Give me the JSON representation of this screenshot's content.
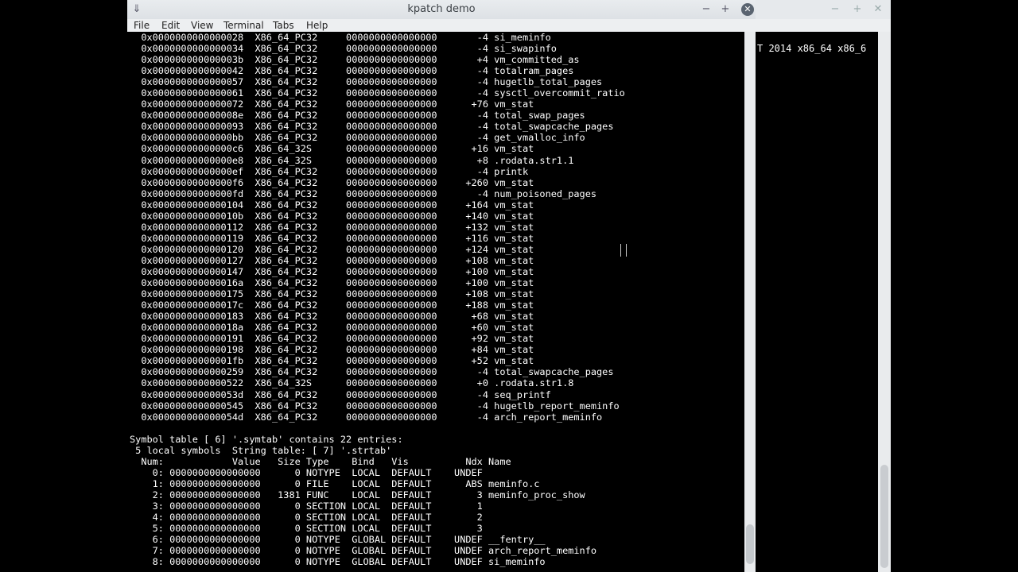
{
  "background_window": {
    "terminal_fragment": "T 2014 x86_64 x86_6",
    "controls": [
      "−",
      "+",
      "✕"
    ]
  },
  "window": {
    "title": "kpatch demo",
    "controls": [
      "−",
      "+",
      "✕"
    ]
  },
  "menu": {
    "file": "File",
    "edit": "Edit",
    "view": "View",
    "terminal": "Terminal",
    "tabs": "Tabs",
    "help": "Help"
  },
  "terminal_lines": [
    "  0x0000000000000028  X86_64_PC32     0000000000000000       -4 si_meminfo",
    "  0x0000000000000034  X86_64_PC32     0000000000000000       -4 si_swapinfo",
    "  0x000000000000003b  X86_64_PC32     0000000000000000       +4 vm_committed_as",
    "  0x0000000000000042  X86_64_PC32     0000000000000000       -4 totalram_pages",
    "  0x0000000000000057  X86_64_PC32     0000000000000000       -4 hugetlb_total_pages",
    "  0x0000000000000061  X86_64_PC32     0000000000000000       -4 sysctl_overcommit_ratio",
    "  0x0000000000000072  X86_64_PC32     0000000000000000      +76 vm_stat",
    "  0x000000000000008e  X86_64_PC32     0000000000000000       -4 total_swap_pages",
    "  0x0000000000000093  X86_64_PC32     0000000000000000       -4 total_swapcache_pages",
    "  0x00000000000000bb  X86_64_PC32     0000000000000000       -4 get_vmalloc_info",
    "  0x00000000000000c6  X86_64_32S      0000000000000000      +16 vm_stat",
    "  0x00000000000000e8  X86_64_32S      0000000000000000       +8 .rodata.str1.1",
    "  0x00000000000000ef  X86_64_PC32     0000000000000000       -4 printk",
    "  0x00000000000000f6  X86_64_PC32     0000000000000000     +260 vm_stat",
    "  0x00000000000000fd  X86_64_PC32     0000000000000000       -4 num_poisoned_pages",
    "  0x0000000000000104  X86_64_PC32     0000000000000000     +164 vm_stat",
    "  0x000000000000010b  X86_64_PC32     0000000000000000     +140 vm_stat",
    "  0x0000000000000112  X86_64_PC32     0000000000000000     +132 vm_stat",
    "  0x0000000000000119  X86_64_PC32     0000000000000000     +116 vm_stat",
    "  0x0000000000000120  X86_64_PC32     0000000000000000     +124 vm_stat",
    "  0x0000000000000127  X86_64_PC32     0000000000000000     +108 vm_stat",
    "  0x0000000000000147  X86_64_PC32     0000000000000000     +100 vm_stat",
    "  0x000000000000016a  X86_64_PC32     0000000000000000     +100 vm_stat",
    "  0x0000000000000175  X86_64_PC32     0000000000000000     +108 vm_stat",
    "  0x000000000000017c  X86_64_PC32     0000000000000000     +188 vm_stat",
    "  0x0000000000000183  X86_64_PC32     0000000000000000      +68 vm_stat",
    "  0x000000000000018a  X86_64_PC32     0000000000000000      +60 vm_stat",
    "  0x0000000000000191  X86_64_PC32     0000000000000000      +92 vm_stat",
    "  0x0000000000000198  X86_64_PC32     0000000000000000      +84 vm_stat",
    "  0x00000000000001fb  X86_64_PC32     0000000000000000      +52 vm_stat",
    "  0x0000000000000259  X86_64_PC32     0000000000000000       -4 total_swapcache_pages",
    "  0x0000000000000522  X86_64_32S      0000000000000000       +0 .rodata.str1.8",
    "  0x000000000000053d  X86_64_PC32     0000000000000000       -4 seq_printf",
    "  0x0000000000000545  X86_64_PC32     0000000000000000       -4 hugetlb_report_meminfo",
    "  0x000000000000054d  X86_64_PC32     0000000000000000       -4 arch_report_meminfo",
    "",
    "Symbol table [ 6] '.symtab' contains 22 entries:",
    " 5 local symbols  String table: [ 7] '.strtab'",
    "  Num:            Value   Size Type    Bind   Vis          Ndx Name",
    "    0: 0000000000000000      0 NOTYPE  LOCAL  DEFAULT    UNDEF",
    "    1: 0000000000000000      0 FILE    LOCAL  DEFAULT      ABS meminfo.c",
    "    2: 0000000000000000   1381 FUNC    LOCAL  DEFAULT        3 meminfo_proc_show",
    "    3: 0000000000000000      0 SECTION LOCAL  DEFAULT        1",
    "    4: 0000000000000000      0 SECTION LOCAL  DEFAULT        2",
    "    5: 0000000000000000      0 SECTION LOCAL  DEFAULT        3",
    "    6: 0000000000000000      0 NOTYPE  GLOBAL DEFAULT    UNDEF __fentry__",
    "    7: 0000000000000000      0 NOTYPE  GLOBAL DEFAULT    UNDEF arch_report_meminfo",
    "    8: 0000000000000000      0 NOTYPE  GLOBAL DEFAULT    UNDEF si_meminfo"
  ]
}
